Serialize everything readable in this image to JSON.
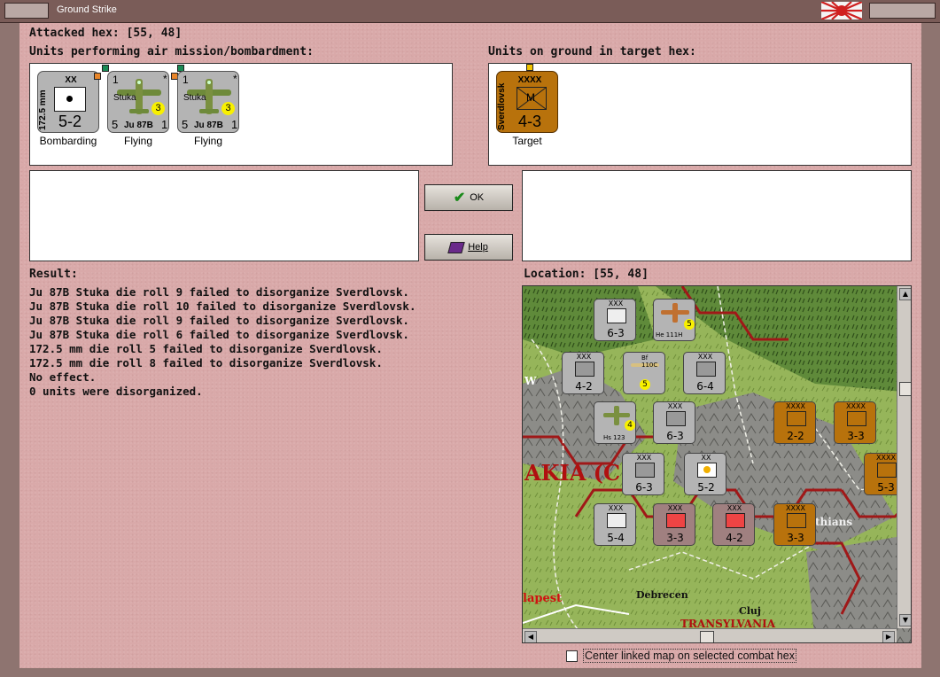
{
  "window": {
    "title": "Ground Strike"
  },
  "attacked": {
    "label": "Attacked hex:",
    "value": "[55, 48]"
  },
  "air_section": {
    "label": "Units performing air mission/bombardment:"
  },
  "ground_section": {
    "label": "Units on ground in target hex:"
  },
  "air_units": [
    {
      "role": "Bombarding",
      "top": "XX",
      "side": "172.5 mm",
      "strength": "5-2"
    },
    {
      "role": "Flying",
      "name": "Stuka",
      "model": "Ju 87B",
      "tl": "1",
      "bl": "5",
      "br": "1",
      "badge": "3",
      "mark": "*"
    },
    {
      "role": "Flying",
      "name": "Stuka",
      "model": "Ju 87B",
      "tl": "1",
      "bl": "5",
      "br": "1",
      "badge": "3",
      "mark": "*"
    }
  ],
  "ground_units": [
    {
      "role": "Target",
      "top": "XXXX",
      "side": "Sverdlovsk",
      "symbol": "M",
      "strength": "4-3"
    }
  ],
  "buttons": {
    "ok": "OK",
    "help": "Help"
  },
  "result": {
    "label": "Result:",
    "lines": [
      "Ju 87B Stuka die roll 9 failed to disorganize Sverdlovsk.",
      "Ju 87B Stuka die roll 10 failed to disorganize Sverdlovsk.",
      "Ju 87B Stuka die roll 9 failed to disorganize Sverdlovsk.",
      "Ju 87B Stuka die roll 6 failed to disorganize Sverdlovsk.",
      "172.5 mm die roll 5 failed to disorganize Sverdlovsk.",
      "172.5 mm die roll 8 failed to disorganize Sverdlovsk.",
      "No effect.",
      "0 units were disorganized."
    ]
  },
  "location": {
    "label": "Location:",
    "value": "[55, 48]"
  },
  "map": {
    "place_names": [
      "AKIA (C",
      "thians",
      "lapest",
      "Debrecen",
      "Cluj",
      "TRANSYLVANIA",
      "W"
    ],
    "counters": [
      {
        "top": "XXX",
        "strength": "6-3",
        "side": "XXXVI Inf",
        "stack": "2"
      },
      {
        "top": "XXX",
        "strength": "4-2",
        "side": "Stalin",
        "stack": "3"
      },
      {
        "top": "XXX",
        "strength": "6-4",
        "side": "",
        "stack": "3"
      },
      {
        "top": "XXX",
        "strength": "6-3",
        "side": "XIV Inf",
        "stack": "2"
      },
      {
        "top": "XXX",
        "strength": "6-3",
        "side": "XXXVII Inf",
        "stack": "2"
      },
      {
        "top": "XX",
        "strength": "5-2",
        "side": "172.5",
        "stack": "4"
      },
      {
        "top": "XXX",
        "strength": "5-4",
        "side": "IXIII Inf",
        "stack": ""
      },
      {
        "top": "XXX",
        "strength": "3-3",
        "side": "HUN",
        "stack": "2"
      },
      {
        "top": "XXX",
        "strength": "4-2",
        "side": "HUN",
        "stack": "2"
      },
      {
        "top": "XXXX",
        "strength": "2-2",
        "side": "Sverdlovsk",
        "stack": ""
      },
      {
        "top": "XXXX",
        "strength": "3-3",
        "side": "",
        "stack": ""
      },
      {
        "top": "XXXX",
        "strength": "5-3",
        "side": "",
        "stack": ""
      },
      {
        "top": "XXXX",
        "strength": "3-3",
        "side": "",
        "stack": ""
      }
    ],
    "air_counters": [
      {
        "name": "He 111H",
        "tl": "3",
        "br": "4",
        "badge": "5"
      },
      {
        "name": "Bf 110C",
        "tl": "3",
        "br": "4",
        "badge": "5"
      },
      {
        "name": "Hs 123",
        "tl": "3",
        "br": "1",
        "badge": "4"
      }
    ]
  },
  "footer": {
    "checkbox_label": "Center linked map on selected combat hex",
    "checked": false
  }
}
